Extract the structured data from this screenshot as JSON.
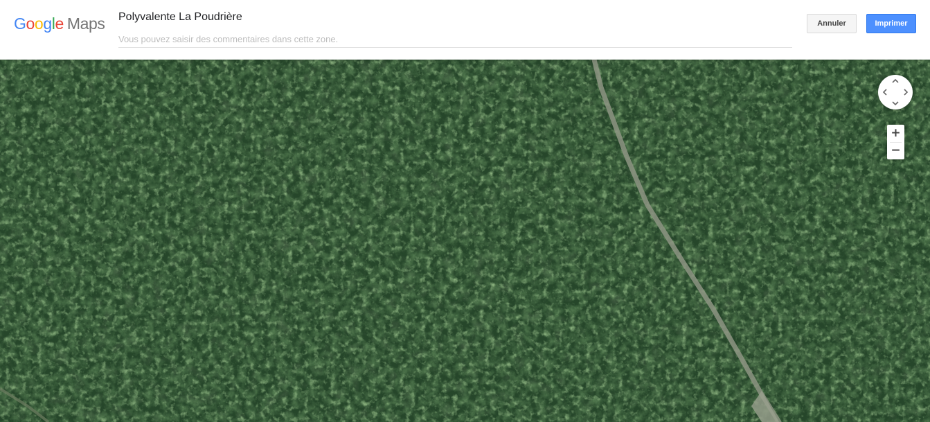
{
  "app": {
    "logo": {
      "google_letters": [
        "G",
        "o",
        "o",
        "g",
        "l",
        "e"
      ],
      "maps_word": "Maps",
      "colors": {
        "blue": "#4285f4",
        "red": "#ea4335",
        "yellow": "#fbbc05",
        "green": "#34a853",
        "maps_gray": "#757575"
      }
    }
  },
  "header": {
    "place_title": "Polyvalente La Poudrière",
    "comment_placeholder": "Vous pouvez saisir des commentaires dans cette zone.",
    "comment_value": "",
    "cancel_label": "Annuler",
    "print_label": "Imprimer",
    "accent_color": "#4d90fe"
  },
  "map": {
    "view": "satellite",
    "pan_control": {
      "icons": [
        "chevron-up-icon",
        "chevron-down-icon",
        "chevron-left-icon",
        "chevron-right-icon"
      ]
    },
    "zoom_control": {
      "zoom_in_label": "+",
      "zoom_out_label": "−"
    },
    "colors": {
      "forest_dark": "#1f3a1d",
      "forest_mid": "#2f5a2a",
      "forest_light": "#4f8a3e",
      "road": "#8a9180"
    }
  }
}
